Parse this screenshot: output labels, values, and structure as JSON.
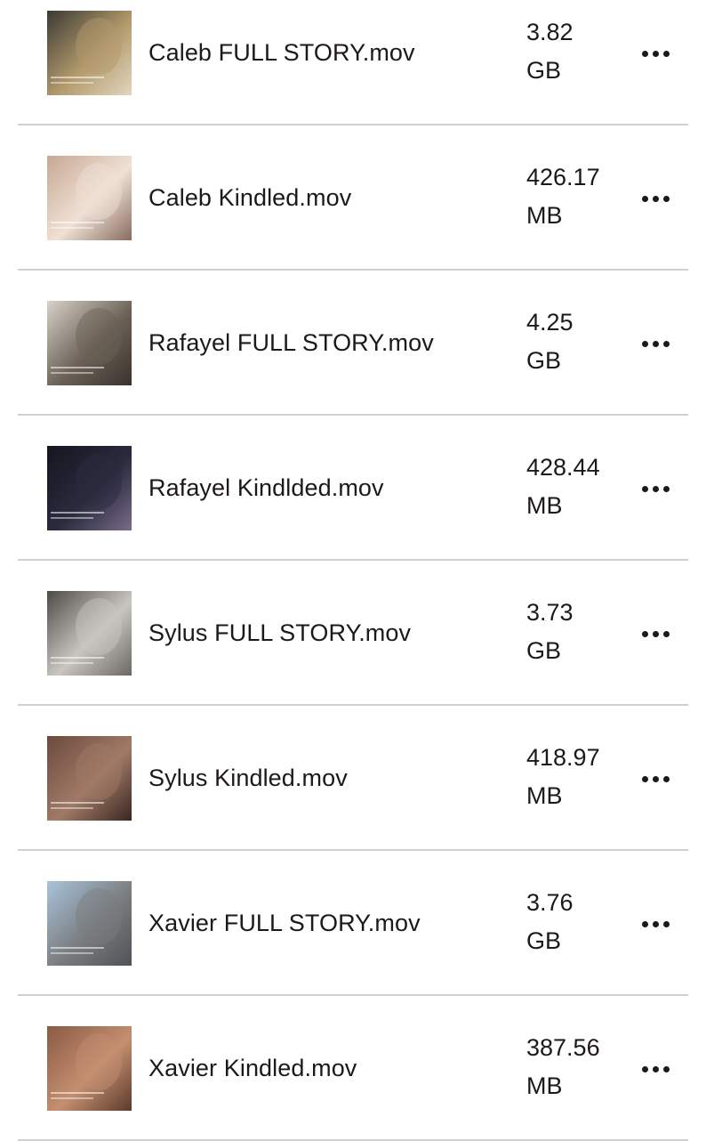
{
  "files": [
    {
      "name": "Caleb FULL STORY.mov",
      "size_value": "3.82",
      "size_unit": "GB",
      "thumb_colors": [
        "#3b3a34",
        "#b39a6c",
        "#e2d6c0"
      ]
    },
    {
      "name": "Caleb Kindled.mov",
      "size_value": "426.17",
      "size_unit": "MB",
      "thumb_colors": [
        "#c7a893",
        "#efe1d5",
        "#8a6b5f"
      ]
    },
    {
      "name": "Rafayel FULL STORY.mov",
      "size_value": "4.25",
      "size_unit": "GB",
      "thumb_colors": [
        "#d9d2c9",
        "#6b6157",
        "#3a332d"
      ]
    },
    {
      "name": "Rafayel Kindlded.mov",
      "size_value": "428.44",
      "size_unit": "MB",
      "thumb_colors": [
        "#14161f",
        "#2a2b3d",
        "#7a6a8a"
      ]
    },
    {
      "name": "Sylus FULL STORY.mov",
      "size_value": "3.73",
      "size_unit": "GB",
      "thumb_colors": [
        "#4e4b47",
        "#c9c6c1",
        "#6b6864"
      ]
    },
    {
      "name": "Sylus Kindled.mov",
      "size_value": "418.97",
      "size_unit": "MB",
      "thumb_colors": [
        "#6b4a3e",
        "#a07a66",
        "#3a2621"
      ]
    },
    {
      "name": "Xavier FULL STORY.mov",
      "size_value": "3.76",
      "size_unit": "GB",
      "thumb_colors": [
        "#a9c3dc",
        "#7a7d7f",
        "#4f5357"
      ]
    },
    {
      "name": "Xavier Kindled.mov",
      "size_value": "387.56",
      "size_unit": "MB",
      "thumb_colors": [
        "#8a5a44",
        "#c48f70",
        "#5a3a2c"
      ]
    }
  ],
  "icons": {
    "more": "more-horizontal-icon"
  }
}
